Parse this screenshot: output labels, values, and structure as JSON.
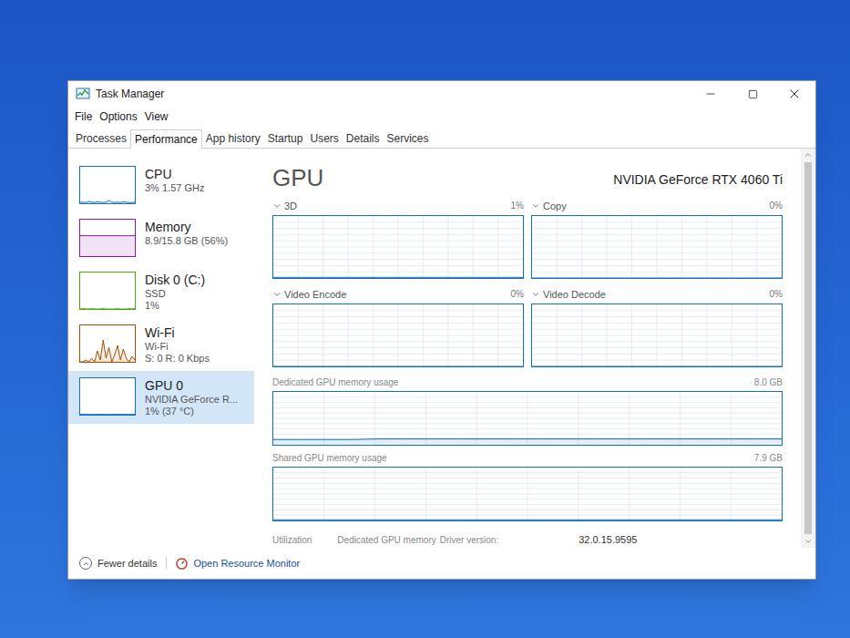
{
  "window": {
    "title": "Task Manager"
  },
  "menu": [
    "File",
    "Options",
    "View"
  ],
  "tabs": [
    {
      "label": "Processes",
      "selected": false
    },
    {
      "label": "Performance",
      "selected": true
    },
    {
      "label": "App history",
      "selected": false
    },
    {
      "label": "Startup",
      "selected": false
    },
    {
      "label": "Users",
      "selected": false
    },
    {
      "label": "Details",
      "selected": false
    },
    {
      "label": "Services",
      "selected": false
    }
  ],
  "sidebar": {
    "items": [
      {
        "name": "CPU",
        "details": [
          "3% 1.57 GHz"
        ],
        "color": "#1170c6",
        "selected": false,
        "values": [
          2,
          3,
          2,
          5,
          3,
          2,
          4,
          3,
          2,
          3,
          8,
          3,
          2,
          3,
          2,
          4,
          3,
          2,
          2,
          3
        ]
      },
      {
        "name": "Memory",
        "details": [
          "8.9/15.8 GB (56%)"
        ],
        "color": "#8b12ae",
        "selected": false,
        "values": [
          56,
          56,
          56,
          56,
          56,
          56,
          56,
          56,
          56,
          56,
          56,
          56,
          56,
          56,
          56,
          56,
          56,
          56,
          56,
          56
        ]
      },
      {
        "name": "Disk 0 (C:)",
        "details": [
          "SSD",
          "1%"
        ],
        "color": "#4da60c",
        "selected": false,
        "values": [
          0,
          1,
          0,
          0,
          1,
          0,
          0,
          0,
          1,
          0,
          0,
          0,
          0,
          1,
          0,
          0,
          0,
          1,
          0,
          1
        ]
      },
      {
        "name": "Wi-Fi",
        "details": [
          "Wi-Fi",
          "S: 0 R: 0 Kbps"
        ],
        "color": "#a74f01",
        "selected": false,
        "values": [
          0,
          0,
          5,
          0,
          10,
          0,
          30,
          5,
          60,
          10,
          40,
          0,
          20,
          45,
          5,
          35,
          10,
          0,
          15,
          5
        ]
      },
      {
        "name": "GPU 0",
        "details": [
          "NVIDIA GeForce R...",
          "1% (37 °C)"
        ],
        "color": "#1170c6",
        "selected": true,
        "values": [
          1,
          1,
          1,
          1,
          1,
          1,
          1,
          1,
          1,
          1,
          1,
          1,
          1,
          1,
          1,
          1,
          1,
          1,
          1,
          1
        ]
      }
    ]
  },
  "panel": {
    "title": "GPU",
    "device": "NVIDIA GeForce RTX 4060 Ti",
    "graphs": [
      {
        "label": "3D",
        "reading": "1%",
        "max": 100,
        "values": [
          1,
          1,
          1,
          1,
          1,
          1,
          1,
          1,
          1,
          1,
          1,
          1,
          1,
          1,
          1,
          1,
          1,
          1,
          1,
          1
        ]
      },
      {
        "label": "Copy",
        "reading": "0%",
        "max": 100,
        "values": [
          0,
          0,
          0,
          0,
          0,
          0,
          0,
          0,
          0,
          0,
          0,
          0,
          0,
          0,
          0,
          0,
          0,
          0,
          0,
          0
        ]
      },
      {
        "label": "Video Encode",
        "reading": "0%",
        "max": 100,
        "values": [
          0,
          0,
          0,
          0,
          0,
          0,
          0,
          0,
          0,
          0,
          0,
          0,
          0,
          0,
          0,
          0,
          0,
          0,
          0,
          0
        ]
      },
      {
        "label": "Video Decode",
        "reading": "0%",
        "max": 100,
        "values": [
          0,
          0,
          0,
          0,
          0,
          0,
          0,
          0,
          0,
          0,
          0,
          0,
          0,
          0,
          0,
          0,
          0,
          0,
          0,
          0
        ]
      }
    ],
    "memory_graphs": [
      {
        "label": "Dedicated GPU memory usage",
        "reading": "8.0 GB",
        "max": 8,
        "values": [
          0.8,
          0.8,
          0.8,
          0.8,
          0.9,
          0.9,
          0.9,
          0.9,
          0.9,
          0.9,
          0.9,
          0.9,
          0.9,
          0.9,
          0.9,
          0.9,
          0.9,
          0.9,
          0.9,
          0.9
        ]
      },
      {
        "label": "Shared GPU memory usage",
        "reading": "7.9 GB",
        "max": 7.9,
        "values": [
          0.1,
          0.1,
          0.1,
          0.1,
          0.1,
          0.1,
          0.1,
          0.1,
          0.1,
          0.1,
          0.1,
          0.1,
          0.1,
          0.1,
          0.1,
          0.1,
          0.1,
          0.1,
          0.1,
          0.1
        ]
      }
    ],
    "stats": [
      "Utilization",
      "Dedicated GPU memory"
    ],
    "driver": {
      "label": "Driver version:",
      "value": "32.0.15.9595"
    }
  },
  "footer": {
    "fewer_details": "Fewer details",
    "resource_monitor": "Open Resource Monitor"
  }
}
